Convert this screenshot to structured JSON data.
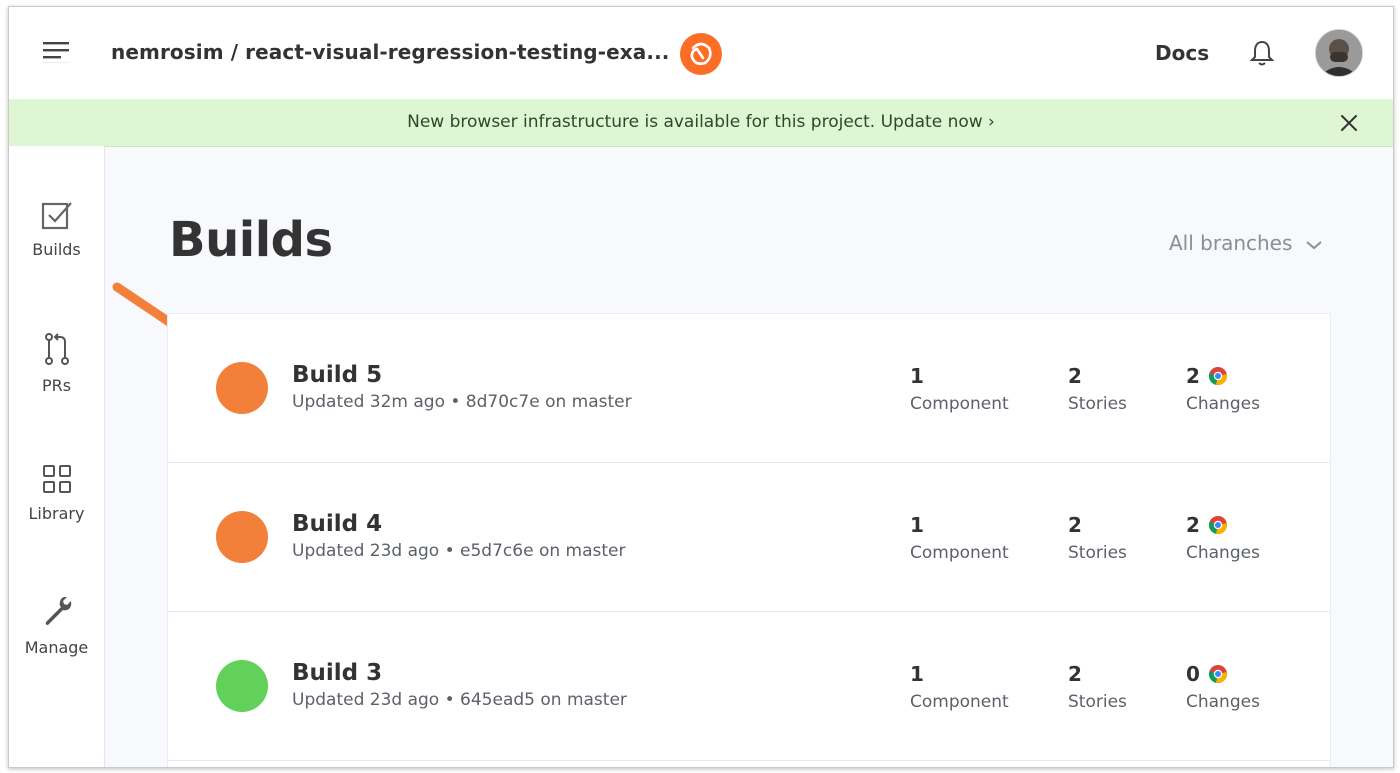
{
  "header": {
    "project_title": "nemrosim / react-visual-regression-testing-exa...",
    "docs_label": "Docs"
  },
  "banner": {
    "text": "New browser infrastructure is available for this project. Update now ›"
  },
  "sidebar": {
    "items": [
      {
        "label": "Builds",
        "icon": "builds-check-icon"
      },
      {
        "label": "PRs",
        "icon": "pull-request-icon"
      },
      {
        "label": "Library",
        "icon": "library-grid-icon"
      },
      {
        "label": "Manage",
        "icon": "wrench-icon"
      }
    ]
  },
  "main": {
    "title": "Builds",
    "branch_filter": "All branches"
  },
  "builds": [
    {
      "name": "Build 5",
      "meta": "Updated 32m ago • 8d70c7e on master",
      "status_color": "#f2803a",
      "components": "1",
      "components_label": "Component",
      "stories": "2",
      "stories_label": "Stories",
      "changes": "2",
      "changes_label": "Changes"
    },
    {
      "name": "Build 4",
      "meta": "Updated 23d ago • e5d7c6e on master",
      "status_color": "#f2803a",
      "components": "1",
      "components_label": "Component",
      "stories": "2",
      "stories_label": "Stories",
      "changes": "2",
      "changes_label": "Changes"
    },
    {
      "name": "Build 3",
      "meta": "Updated 23d ago • 645ead5 on master",
      "status_color": "#62d15b",
      "components": "1",
      "components_label": "Component",
      "stories": "2",
      "stories_label": "Stories",
      "changes": "0",
      "changes_label": "Changes"
    }
  ],
  "colors": {
    "accent_orange": "#f2803a",
    "success_green": "#62d15b",
    "banner_bg": "#dff6d4"
  }
}
